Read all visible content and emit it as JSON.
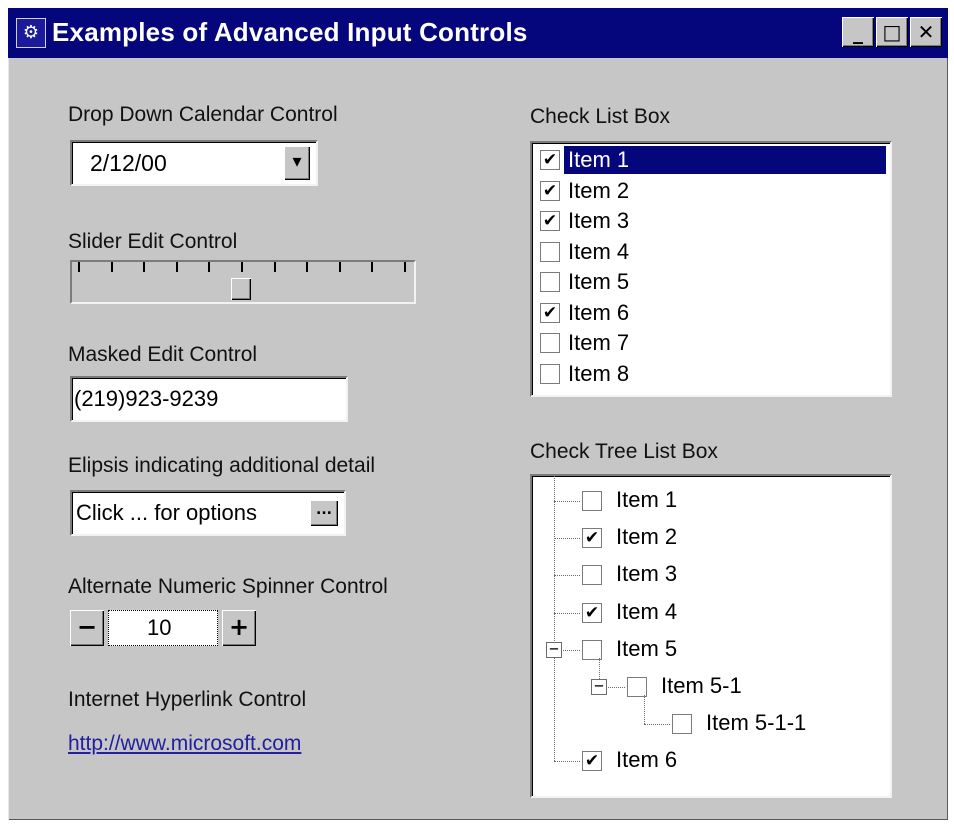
{
  "window": {
    "title": "Examples of Advanced Input Controls",
    "icon": "app-icon",
    "buttons": {
      "minimize": "_",
      "maximize": "□",
      "close": "✕"
    }
  },
  "left": {
    "calendar": {
      "label": "Drop Down Calendar Control",
      "value": "2/12/00",
      "dropdown_glyph": "▾"
    },
    "slider": {
      "label": "Slider Edit Control",
      "ticks": 11,
      "value_fraction": 0.5
    },
    "masked": {
      "label": "Masked Edit Control",
      "value": "(219)923-9239"
    },
    "ellipsis": {
      "label": "Elipsis indicating additional detail",
      "value": "Click ... for options",
      "button": "..."
    },
    "spinner": {
      "label": "Alternate Numeric Spinner Control",
      "minus": "−",
      "value": "10",
      "plus": "+"
    },
    "hyperlink": {
      "label": "Internet Hyperlink Control",
      "url": "http://www.microsoft.com"
    }
  },
  "right": {
    "checklist": {
      "label": "Check List Box",
      "items": [
        {
          "label": "Item 1",
          "checked": true,
          "selected": true
        },
        {
          "label": "Item 2",
          "checked": true
        },
        {
          "label": "Item 3",
          "checked": true
        },
        {
          "label": "Item 4",
          "checked": false
        },
        {
          "label": "Item 5",
          "checked": false
        },
        {
          "label": "Item 6",
          "checked": true
        },
        {
          "label": "Item 7",
          "checked": false
        },
        {
          "label": "Item 8",
          "checked": false
        }
      ]
    },
    "checktree": {
      "label": "Check Tree List Box",
      "collapse_glyph": "−",
      "items": [
        {
          "label": "Item 1",
          "checked": false,
          "level": 0
        },
        {
          "label": "Item 2",
          "checked": true,
          "level": 0
        },
        {
          "label": "Item 3",
          "checked": false,
          "level": 0
        },
        {
          "label": "Item 4",
          "checked": true,
          "level": 0
        },
        {
          "label": "Item 5",
          "checked": false,
          "level": 0,
          "expanded": true
        },
        {
          "label": "Item 5-1",
          "checked": false,
          "level": 1,
          "expanded": true
        },
        {
          "label": "Item 5-1-1",
          "checked": false,
          "level": 2
        },
        {
          "label": "Item 6",
          "checked": true,
          "level": 0
        }
      ]
    }
  },
  "colors": {
    "face": "#c6c6c6",
    "titlebar": "#06067c",
    "highlight": "#06067c",
    "link": "#2020a0"
  }
}
